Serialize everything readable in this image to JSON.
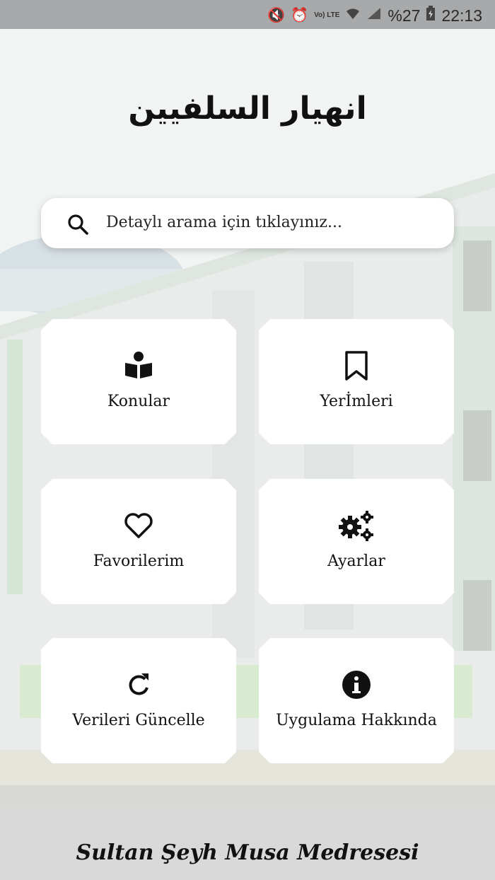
{
  "status_bar": {
    "battery": "%27",
    "time": "22:13",
    "network": "Vo) LTE"
  },
  "app": {
    "title": "انهيار السلفيين"
  },
  "search": {
    "placeholder": "Detaylı arama için tıklayınız..."
  },
  "menu": [
    {
      "label": "Konular",
      "icon": "book-reader-icon"
    },
    {
      "label": "Yerİmleri",
      "icon": "bookmark-icon"
    },
    {
      "label": "Favorilerim",
      "icon": "heart-icon"
    },
    {
      "label": "Ayarlar",
      "icon": "gears-icon"
    },
    {
      "label": "Verileri Güncelle",
      "icon": "refresh-icon"
    },
    {
      "label": "Uygulama Hakkında",
      "icon": "info-icon"
    }
  ],
  "footer": {
    "text": "Sultan Şeyh Musa Medresesi"
  },
  "colors": {
    "card": "#ffffff",
    "status_bar": "#a7a9aa",
    "accent_green": "#9cc38a"
  }
}
